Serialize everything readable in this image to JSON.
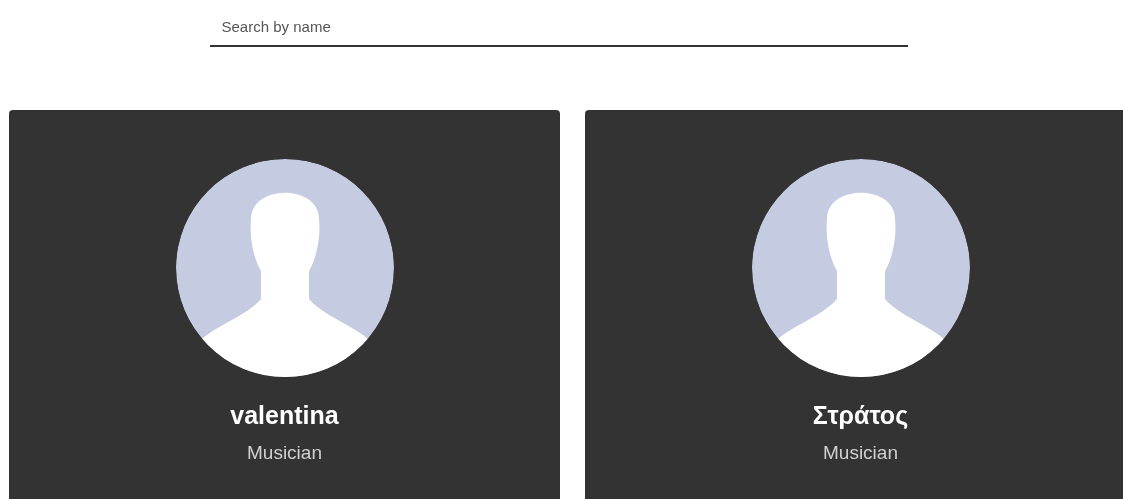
{
  "search": {
    "placeholder": "Search by name"
  },
  "profiles": [
    {
      "name": "valentina",
      "role": "Musician"
    },
    {
      "name": "Στράτος",
      "role": "Musician"
    }
  ]
}
